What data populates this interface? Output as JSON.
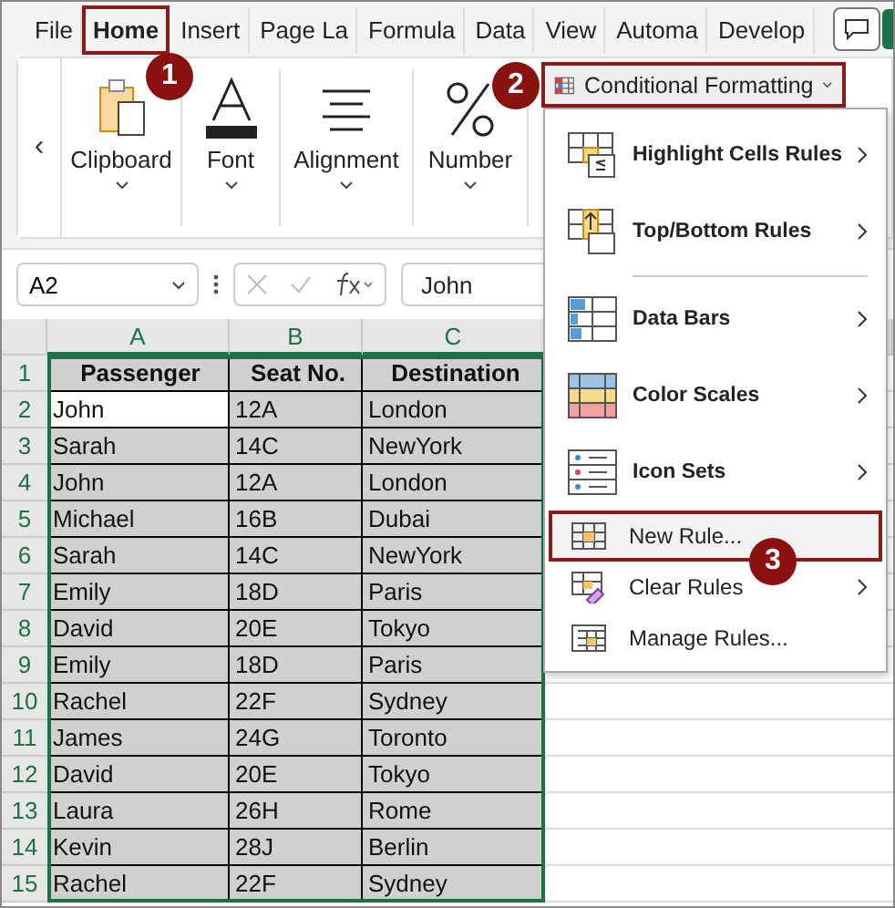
{
  "tabs": [
    {
      "label": "File",
      "selected": false,
      "outlined": false
    },
    {
      "label": "Home",
      "selected": true,
      "outlined": true
    },
    {
      "label": "Insert",
      "selected": false,
      "outlined": false
    },
    {
      "label": "Page La",
      "selected": false,
      "outlined": false
    },
    {
      "label": "Formula",
      "selected": false,
      "outlined": false
    },
    {
      "label": "Data",
      "selected": false,
      "outlined": false
    },
    {
      "label": "View",
      "selected": false,
      "outlined": false
    },
    {
      "label": "Automa",
      "selected": false,
      "outlined": false
    },
    {
      "label": "Develop",
      "selected": false,
      "outlined": false
    }
  ],
  "ribbon": {
    "scroll_left": "‹",
    "groups": [
      {
        "label": "Clipboard"
      },
      {
        "label": "Font"
      },
      {
        "label": "Alignment"
      },
      {
        "label": "Number"
      }
    ],
    "conditional_formatting": {
      "label": "Conditional Formatting",
      "outlined": true
    }
  },
  "formula_bar": {
    "name_box": "A2",
    "value": "John"
  },
  "sheet": {
    "columns": [
      "A",
      "B",
      "C"
    ],
    "rows": [
      {
        "number": "1",
        "cells": [
          "Passenger",
          "Seat No.",
          "Destination"
        ]
      },
      {
        "number": "2",
        "cells": [
          "John",
          "12A",
          "London"
        ]
      },
      {
        "number": "3",
        "cells": [
          "Sarah",
          "14C",
          "NewYork"
        ]
      },
      {
        "number": "4",
        "cells": [
          "John",
          "12A",
          "London"
        ]
      },
      {
        "number": "5",
        "cells": [
          "Michael",
          "16B",
          "Dubai"
        ]
      },
      {
        "number": "6",
        "cells": [
          "Sarah",
          "14C",
          "NewYork"
        ]
      },
      {
        "number": "7",
        "cells": [
          "Emily",
          "18D",
          "Paris"
        ]
      },
      {
        "number": "8",
        "cells": [
          "David",
          "20E",
          "Tokyo"
        ]
      },
      {
        "number": "9",
        "cells": [
          "Emily",
          "18D",
          "Paris"
        ]
      },
      {
        "number": "10",
        "cells": [
          "Rachel",
          "22F",
          "Sydney"
        ]
      },
      {
        "number": "11",
        "cells": [
          "James",
          "24G",
          "Toronto"
        ]
      },
      {
        "number": "12",
        "cells": [
          "David",
          "20E",
          "Tokyo"
        ]
      },
      {
        "number": "13",
        "cells": [
          "Laura",
          "26H",
          "Rome"
        ]
      },
      {
        "number": "14",
        "cells": [
          "Kevin",
          "28J",
          "Berlin"
        ]
      },
      {
        "number": "15",
        "cells": [
          "Rachel",
          "22F",
          "Sydney"
        ]
      }
    ]
  },
  "menu": {
    "items": [
      {
        "label": "Highlight Cells Rules",
        "kind": "large",
        "submenu": true,
        "outlined": false,
        "divider_before": false
      },
      {
        "label": "Top/Bottom Rules",
        "kind": "large",
        "submenu": true,
        "outlined": false,
        "divider_before": false
      },
      {
        "label": "Data Bars",
        "kind": "large",
        "submenu": true,
        "outlined": false,
        "divider_before": true
      },
      {
        "label": "Color Scales",
        "kind": "large",
        "submenu": true,
        "outlined": false,
        "divider_before": false
      },
      {
        "label": "Icon Sets",
        "kind": "large",
        "submenu": true,
        "outlined": false,
        "divider_before": false
      },
      {
        "label": "New Rule...",
        "kind": "small",
        "submenu": false,
        "outlined": true,
        "divider_before": false
      },
      {
        "label": "Clear Rules",
        "kind": "small",
        "submenu": true,
        "outlined": false,
        "divider_before": false
      },
      {
        "label": "Manage Rules...",
        "kind": "small",
        "submenu": false,
        "outlined": false,
        "divider_before": false
      }
    ]
  },
  "badges": [
    "1",
    "2",
    "3"
  ]
}
